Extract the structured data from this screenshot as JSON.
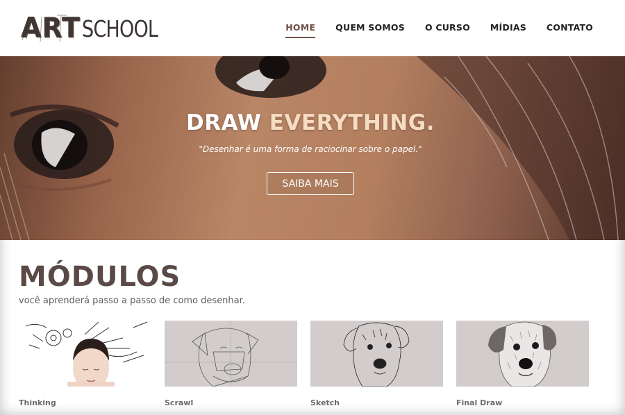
{
  "header": {
    "logo": {
      "part1": "ART",
      "part2": "SCHOOL"
    },
    "nav": [
      {
        "label": "HOME",
        "active": true
      },
      {
        "label": "QUEM SOMOS",
        "active": false
      },
      {
        "label": "O CURSO",
        "active": false
      },
      {
        "label": "MÍDIAS",
        "active": false
      },
      {
        "label": "CONTATO",
        "active": false
      }
    ]
  },
  "hero": {
    "title_part1": "DRAW",
    "title_part2": "EVERYTHING.",
    "quote": "\"Desenhar é uma forma de raciocinar sobre o papel.\"",
    "button_label": "SAIBA MAIS"
  },
  "modules": {
    "title": "MÓDULOS",
    "subtitle": "você aprenderá passo a passo de como desenhar.",
    "cards": [
      {
        "label": "Thinking",
        "image": "woman-with-drawing-tools-illustration"
      },
      {
        "label": "Scrawl",
        "image": "dog-construction-lines-sketch"
      },
      {
        "label": "Sketch",
        "image": "dog-line-sketch"
      },
      {
        "label": "Final Draw",
        "image": "dog-shaded-drawing"
      }
    ]
  },
  "colors": {
    "brand": "#6e5147",
    "heading": "#5a4a46",
    "accent_title": "#f6dcc2",
    "thumb_bg": "#d2cdcc"
  }
}
